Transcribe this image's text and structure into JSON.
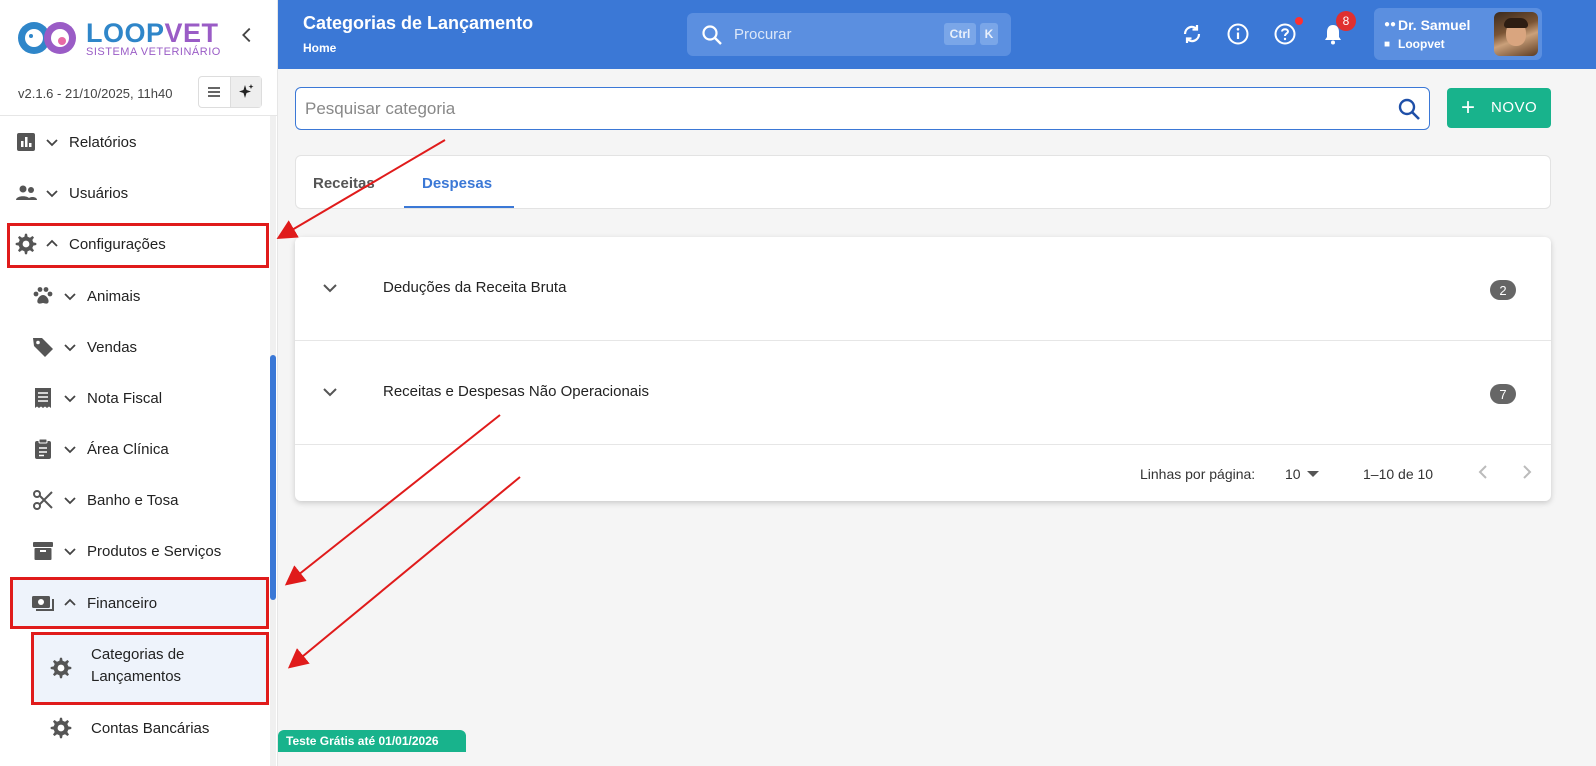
{
  "brand": {
    "name_part1": "LOOP",
    "name_part2": "VET",
    "subtitle": "SISTEMA VETERINÁRIO",
    "primary_color": "#3b78d6",
    "accent_color": "#18b38c"
  },
  "version": "v2.1.6 - 21/10/2025, 11h40",
  "sidebar": {
    "items": [
      {
        "label": "Relatórios",
        "icon": "chart-icon"
      },
      {
        "label": "Usuários",
        "icon": "people-icon"
      },
      {
        "label": "Configurações",
        "icon": "gear-icon"
      },
      {
        "label": "Animais",
        "icon": "paw-icon"
      },
      {
        "label": "Vendas",
        "icon": "tag-icon"
      },
      {
        "label": "Nota Fiscal",
        "icon": "receipt-icon"
      },
      {
        "label": "Área Clínica",
        "icon": "clipboard-icon"
      },
      {
        "label": "Banho e Tosa",
        "icon": "scissors-icon"
      },
      {
        "label": "Produtos e Serviços",
        "icon": "archive-icon"
      },
      {
        "label": "Financeiro",
        "icon": "money-icon"
      },
      {
        "label_line1": "Categorias de",
        "label_line2": "Lançamentos",
        "icon": "gear-icon"
      },
      {
        "label": "Contas Bancárias",
        "icon": "gear-icon"
      }
    ]
  },
  "header": {
    "title": "Categorias de Lançamento",
    "breadcrumb": "Home",
    "search_placeholder": "Procurar",
    "kbd_ctrl": "Ctrl",
    "kbd_k": "K",
    "notification_count": "8",
    "user_name": "Dr. Samuel",
    "clinic_name": "Loopvet"
  },
  "category_search": {
    "placeholder": "Pesquisar categoria"
  },
  "new_button": {
    "plus": "+",
    "label": "NOVO"
  },
  "tabs": [
    {
      "label": "Receitas",
      "active": false
    },
    {
      "label": "Despesas",
      "active": true
    }
  ],
  "table": {
    "rows": [
      {
        "name": "Deduções da Receita Bruta",
        "count": "2"
      },
      {
        "name": "Receitas e Despesas Não Operacionais",
        "count": "7"
      }
    ],
    "pagination": {
      "rows_per_page_label": "Linhas por página:",
      "rows_per_page_value": "10",
      "range": "1–10 de 10"
    }
  },
  "trial_banner": "Teste Grátis até 01/01/2026"
}
